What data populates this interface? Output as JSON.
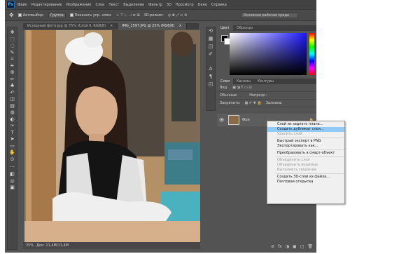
{
  "app": {
    "logo": "Ps"
  },
  "menu": [
    "Файл",
    "Редактирование",
    "Изображение",
    "Слои",
    "Текст",
    "Выделение",
    "Фильтр",
    "3D",
    "Просмотр",
    "Окно",
    "Справка"
  ],
  "options": {
    "autoselect": "Автовыбор:",
    "autoselect_value": "Группа",
    "show_controls": "Показать упр. элем.",
    "mode3d": "3D-режим:",
    "workspace": "Основная рабочая среда"
  },
  "doc_tabs": [
    {
      "label": "Исходный фото.jpg @ 75% (Слой 0, RGB/8)",
      "close": "×",
      "active": false
    },
    {
      "label": "IMG_1597.JPG @ 25% (RGB/8)",
      "close": "×",
      "active": true
    }
  ],
  "status": {
    "zoom": "25%",
    "doc": "Док: 11,4M/11,4M"
  },
  "tools": [
    "move-icon",
    "marquee-icon",
    "lasso-icon",
    "quick-select-icon",
    "crop-icon",
    "eyedropper-icon",
    "healing-icon",
    "brush-icon",
    "stamp-icon",
    "history-brush-icon",
    "eraser-icon",
    "gradient-icon",
    "blur-icon",
    "dodge-icon",
    "pen-icon",
    "text-icon",
    "path-select-icon",
    "shape-icon",
    "hand-icon",
    "zoom-icon",
    "more-icon",
    "fg-bg-icon",
    "quickmask-icon",
    "screenmode-icon"
  ],
  "tool_glyphs": [
    "✥",
    "⬚",
    "◌",
    "✎",
    "⌗",
    "✒",
    "⊕",
    "✏",
    "♣",
    "↶",
    "◫",
    "▤",
    "◍",
    "◐",
    "✑",
    "T",
    "➤",
    "▭",
    "✋",
    "⊙",
    "…",
    "◧",
    "◎",
    "▣"
  ],
  "color_panel": {
    "tabs": [
      "Цвет",
      "Образцы"
    ],
    "fg": "#000000",
    "bg": "#ffffff"
  },
  "layers_panel": {
    "tabs": [
      "Слои",
      "Каналы",
      "Контуры"
    ],
    "kind": "Вид",
    "mode": "Обычные",
    "opacity_label": "Непрозр.:",
    "lock_label": "Закрепить:",
    "fill_label": "Заливка:",
    "layer": {
      "name": "Фон",
      "eye": "👁",
      "lock": "🔒"
    },
    "bottom_icons": [
      "⊘",
      "fx",
      "◑",
      "▣",
      "▢",
      "🗑"
    ]
  },
  "context_menu": [
    {
      "label": "Слой из заднего плана...",
      "state": "normal"
    },
    {
      "label": "Создать дубликат слоя...",
      "state": "highlighted"
    },
    {
      "label": "Удалить слой",
      "state": "disabled"
    },
    {
      "sep": true
    },
    {
      "label": "Быстрый экспорт в PNG",
      "state": "normal"
    },
    {
      "label": "Экспортировать как...",
      "state": "normal"
    },
    {
      "sep": true
    },
    {
      "label": "Преобразовать в смарт-объект",
      "state": "normal"
    },
    {
      "sep": true
    },
    {
      "label": "Объединить слои",
      "state": "disabled"
    },
    {
      "label": "Объединить видимые",
      "state": "disabled"
    },
    {
      "label": "Выполнить сведение",
      "state": "disabled"
    },
    {
      "sep": true
    },
    {
      "label": "Создать 3D-слой из файла...",
      "state": "normal"
    },
    {
      "label": "Почтовая открытка",
      "state": "normal"
    }
  ]
}
